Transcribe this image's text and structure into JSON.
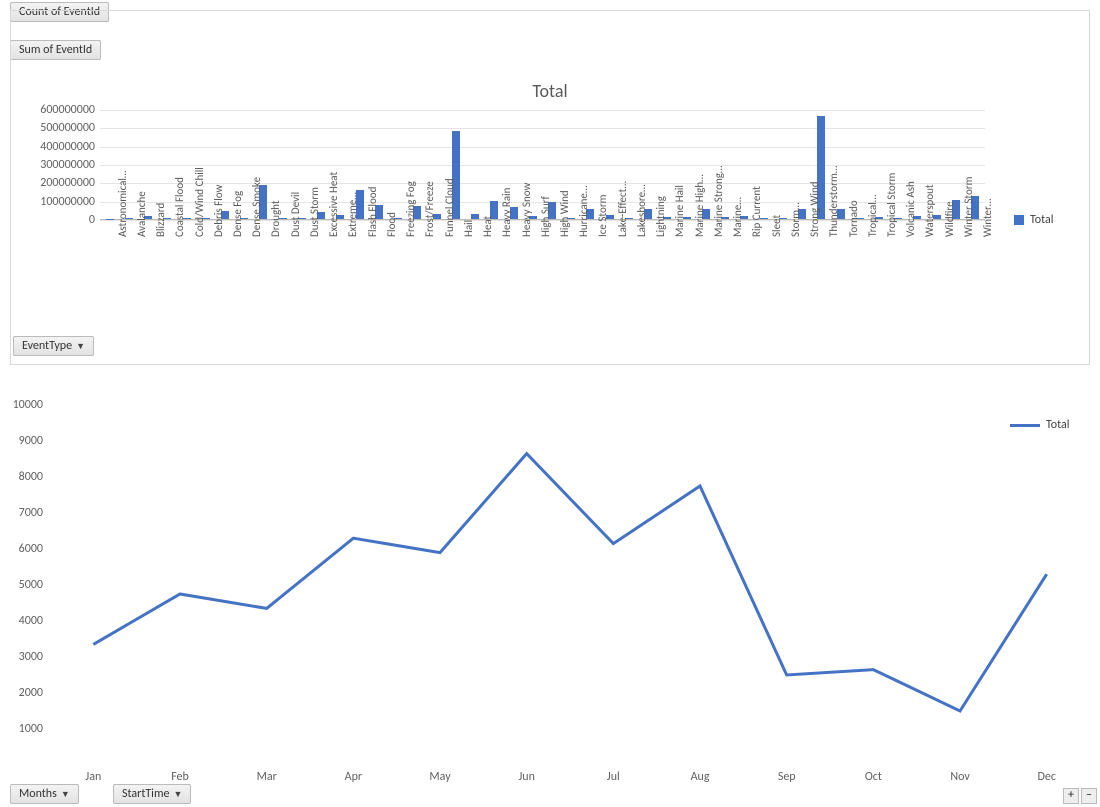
{
  "pills": {
    "count": "Count of EventId",
    "sum": "Sum of EventId",
    "eventType": "EventType",
    "months": "Months",
    "startTime": "StartTime"
  },
  "legend": {
    "label": "Total"
  },
  "zoom": {
    "plus": "+",
    "minus": "–"
  },
  "chart_data": [
    {
      "type": "bar",
      "title": "Total",
      "ylim": [
        0,
        600000000
      ],
      "yTicks": [
        0,
        100000000,
        200000000,
        300000000,
        400000000,
        500000000,
        600000000
      ],
      "categories": [
        "Astronomical…",
        "Avalanche",
        "Blizzard",
        "Coastal Flood",
        "Cold/Wind Chill",
        "Debris Flow",
        "Dense Fog",
        "Dense Smoke",
        "Drought",
        "Dust Devil",
        "Dust Storm",
        "Excessive Heat",
        "Extreme…",
        "Flash Flood",
        "Flood",
        "Freezing Fog",
        "Frost/Freeze",
        "Funnel Cloud",
        "Hail",
        "Heat",
        "Heavy Rain",
        "Heavy Snow",
        "High Surf",
        "High Wind",
        "Hurricane…",
        "Ice Storm",
        "Lake-Effect…",
        "Lakeshore…",
        "Lightning",
        "Marine Hail",
        "Marine High…",
        "Marine Strong…",
        "Marine…",
        "Rip Current",
        "Sleet",
        "Storm…",
        "Strong Wind",
        "Thunderstorm…",
        "Tornado",
        "Tropical…",
        "Tropical Storm",
        "Volcanic Ash",
        "Waterspout",
        "Wildfire",
        "Winter Storm",
        "Winter…"
      ],
      "values": [
        1000000,
        8000000,
        15000000,
        5000000,
        8000000,
        5000000,
        45000000,
        5000000,
        185000000,
        5000000,
        5000000,
        40000000,
        20000000,
        160000000,
        75000000,
        5000000,
        70000000,
        25000000,
        480000000,
        30000000,
        100000000,
        65000000,
        15000000,
        95000000,
        5000000,
        55000000,
        20000000,
        3000000,
        55000000,
        10000000,
        10000000,
        55000000,
        10000000,
        15000000,
        5000000,
        3000000,
        55000000,
        560000000,
        55000000,
        5000000,
        10000000,
        3000000,
        15000000,
        20000000,
        105000000,
        125000000
      ],
      "series_name": "Total"
    },
    {
      "type": "line",
      "ylim": [
        0,
        10000
      ],
      "yTicks": [
        1000,
        2000,
        3000,
        4000,
        5000,
        6000,
        7000,
        8000,
        9000,
        10000
      ],
      "categories": [
        "Jan",
        "Feb",
        "Mar",
        "Apr",
        "May",
        "Jun",
        "Jul",
        "Aug",
        "Sep",
        "Oct",
        "Nov",
        "Dec"
      ],
      "values": [
        3350,
        4750,
        4350,
        6300,
        5900,
        8650,
        6150,
        7750,
        2500,
        2650,
        1500,
        5300
      ],
      "series_name": "Total"
    }
  ]
}
